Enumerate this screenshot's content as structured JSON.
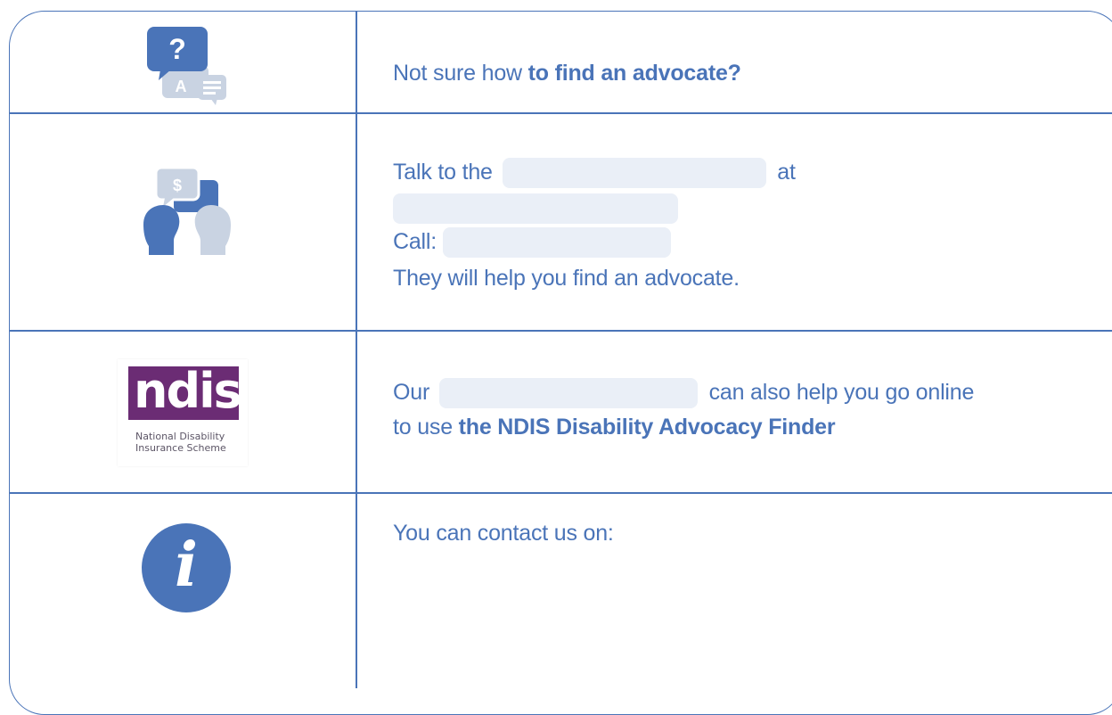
{
  "rows": [
    {
      "icon": "question-answer-icon",
      "text_before": "Not sure how ",
      "text_bold": "to find an advocate?"
    },
    {
      "icon": "two-people-talking-money-icon",
      "line1_before": "Talk to the",
      "line1_after": "at",
      "line3_label": "Call:",
      "line4": "They will help you find an advocate."
    },
    {
      "logo_word": "ndis",
      "logo_sub1": "National Disability",
      "logo_sub2": "Insurance Scheme",
      "line1_before": "Our",
      "line1_after": "can also help you go online",
      "line2_before": "to use ",
      "line2_bold": "the NDIS Disability Advocacy Finder"
    },
    {
      "icon": "info-icon",
      "info_glyph": "i",
      "text": "You can contact us on:"
    }
  ],
  "colors": {
    "text_blue": "#4a74b8",
    "border_blue": "#4a74b8",
    "redaction": "#eaeff7",
    "ndis_purple": "#6b2c74",
    "icon_grey": "#c9d3e2"
  }
}
